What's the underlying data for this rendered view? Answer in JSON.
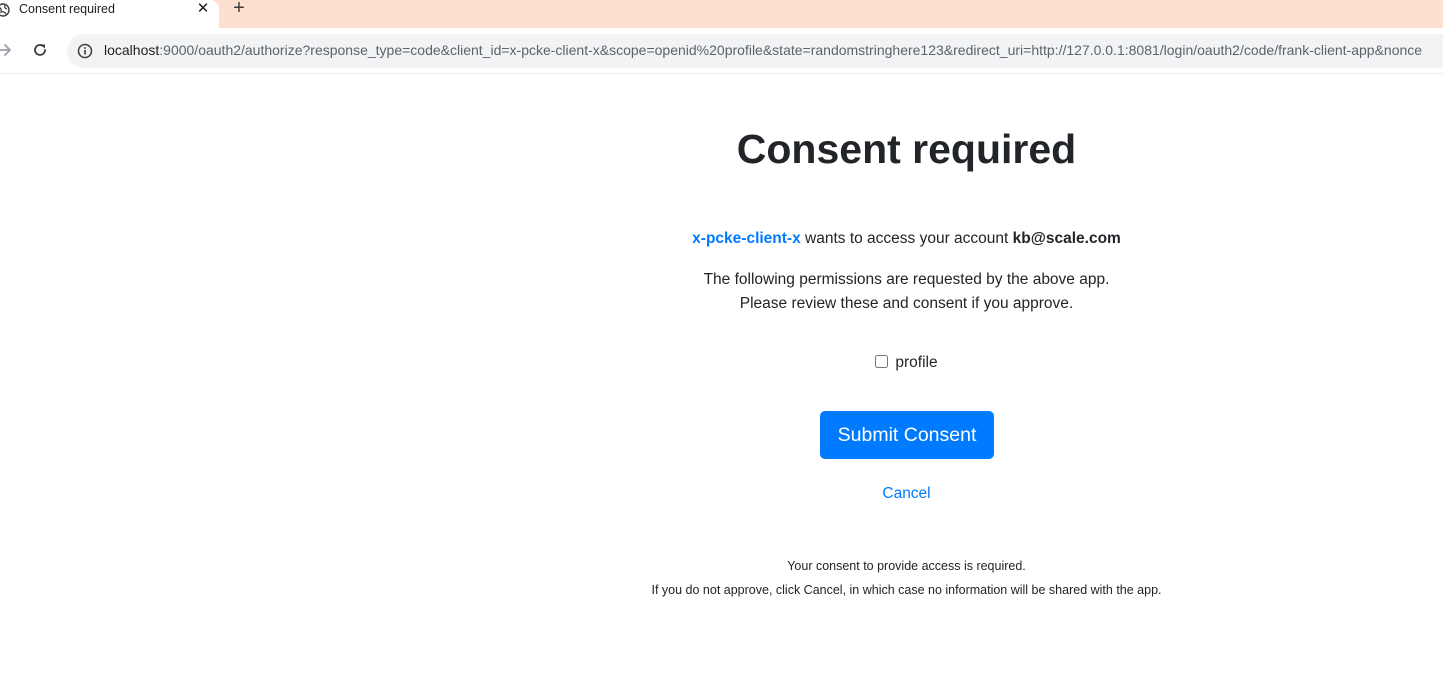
{
  "browser": {
    "tab_title": "Consent required",
    "tab_close_glyph": "✕",
    "new_tab_glyph": "+",
    "url_host": "localhost",
    "url_rest": ":9000/oauth2/authorize?response_type=code&client_id=x-pcke-client-x&scope=openid%20profile&state=randomstringhere123&redirect_uri=http://127.0.0.1:8081/login/oauth2/code/frank-client-app&nonce",
    "icons": {
      "favicon": "globe-icon",
      "forward": "arrow-right-icon",
      "reload": "reload-icon",
      "site_info": "info-icon"
    }
  },
  "page": {
    "title": "Consent required",
    "client_name": "x-pcke-client-x",
    "intro_text": " wants to access your account ",
    "account": "kb@scale.com",
    "permissions_line1": "The following permissions are requested by the above app.",
    "permissions_line2": "Please review these and consent if you approve.",
    "scopes": [
      {
        "label": "profile",
        "checked": false
      }
    ],
    "submit_label": "Submit Consent",
    "cancel_label": "Cancel",
    "note_line1": "Your consent to provide access is required.",
    "note_line2": "If you do not approve, click Cancel, in which case no information will be shared with the app."
  },
  "colors": {
    "accent": "#007bff",
    "tabstrip": "#fde0cf",
    "text": "#212529"
  }
}
